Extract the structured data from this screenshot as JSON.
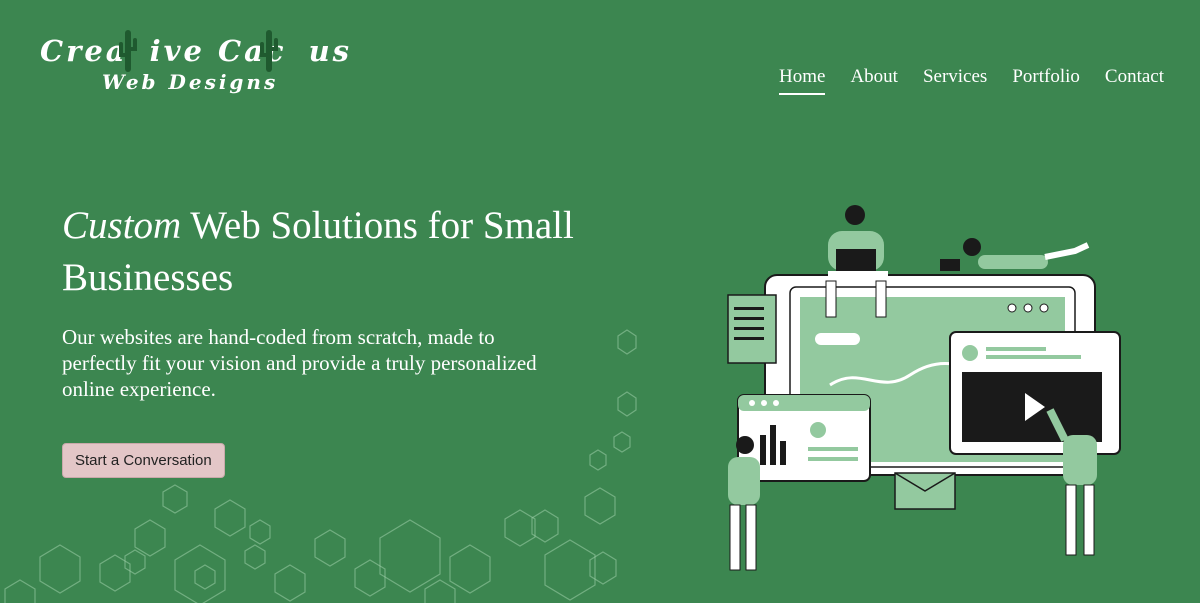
{
  "brand": {
    "line1_part1": "Crea",
    "line1_part2": "ive Cac",
    "line1_part3": "us",
    "line2": "Web Designs"
  },
  "nav": {
    "items": [
      {
        "label": "Home"
      },
      {
        "label": "About"
      },
      {
        "label": "Services"
      },
      {
        "label": "Portfolio"
      },
      {
        "label": "Contact"
      }
    ]
  },
  "hero": {
    "title_emphasis": "Custom",
    "title_rest": " Web Solutions for Small Businesses",
    "subtitle": "Our websites are hand-coded from scratch, made to perfectly fit your vision and provide a truly personalized online experience.",
    "cta_label": "Start a Conversation"
  },
  "colors": {
    "background": "#3c8650",
    "accent_light_green": "#93c99f",
    "button_bg": "#e3c6c7",
    "dark": "#1a1a1a"
  },
  "icons": [
    "cactus-icon",
    "hexagon-pattern",
    "web-design-illustration",
    "play-icon"
  ]
}
